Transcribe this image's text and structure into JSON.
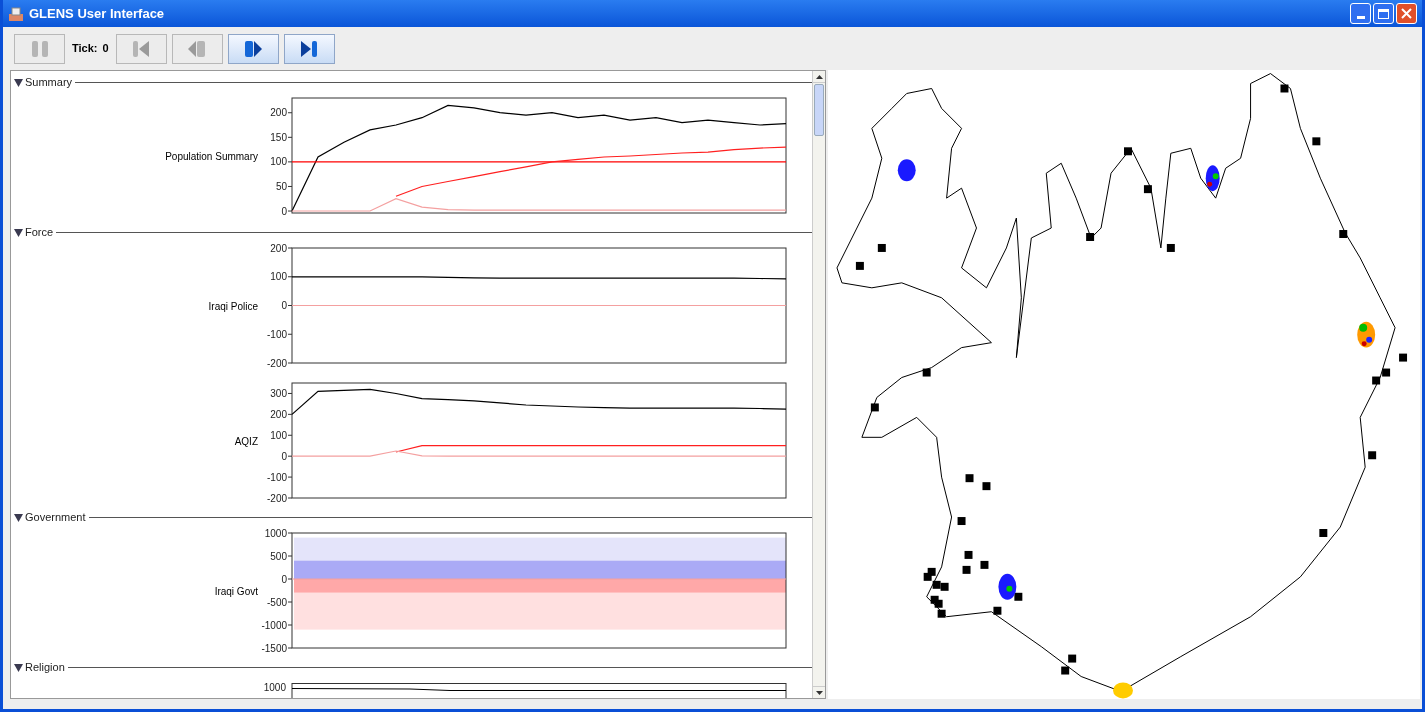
{
  "window": {
    "title": "GLENS User Interface"
  },
  "toolbar": {
    "pause_button": {
      "kind": "pause",
      "disabled": true
    },
    "tick_label": "Tick:",
    "tick_value": "0",
    "buttons": [
      {
        "kind": "first",
        "disabled": true
      },
      {
        "kind": "back",
        "disabled": true
      },
      {
        "kind": "play",
        "disabled": false
      },
      {
        "kind": "last",
        "disabled": false
      }
    ]
  },
  "sections": [
    {
      "title": "Summary",
      "expanded": true,
      "charts": [
        {
          "label": "Population Summary",
          "chart_data": {
            "type": "line",
            "ylim": [
              -4,
              230
            ],
            "yticks": [
              0,
              50,
              100,
              150,
              200
            ],
            "series": [
              {
                "color": "#000000",
                "values": [
                  0,
                  110,
                  140,
                  165,
                  175,
                  190,
                  215,
                  210,
                  200,
                  195,
                  200,
                  190,
                  195,
                  185,
                  190,
                  180,
                  185,
                  180,
                  175,
                  178
                ]
              },
              {
                "color": "#ff0000",
                "values": [
                  100,
                  100,
                  100,
                  100,
                  100,
                  100,
                  100,
                  100,
                  100,
                  100,
                  100,
                  100,
                  100,
                  100,
                  100,
                  100,
                  100,
                  100,
                  100,
                  100
                ]
              },
              {
                "color": "#ff2020",
                "values": [
                  null,
                  null,
                  null,
                  null,
                  30,
                  50,
                  60,
                  70,
                  80,
                  90,
                  100,
                  105,
                  110,
                  112,
                  115,
                  118,
                  120,
                  125,
                  128,
                  130
                ]
              },
              {
                "color": "#f4a0a0",
                "values": [
                  0,
                  0,
                  0,
                  0,
                  25,
                  8,
                  3,
                  2,
                  2,
                  2,
                  2,
                  2,
                  2,
                  2,
                  2,
                  2,
                  2,
                  2,
                  2,
                  2
                ]
              }
            ]
          }
        }
      ]
    },
    {
      "title": "Force",
      "expanded": true,
      "charts": [
        {
          "label": "Iraqi Police",
          "chart_data": {
            "type": "line",
            "ylim": [
              -200,
              200
            ],
            "yticks": [
              -200,
              -100,
              0,
              100,
              200
            ],
            "series": [
              {
                "color": "#000000",
                "values": [
                  100,
                  100,
                  100,
                  100,
                  100,
                  100,
                  98,
                  96,
                  95,
                  95,
                  95,
                  95,
                  95,
                  95,
                  95,
                  95,
                  95,
                  95,
                  94,
                  93
                ]
              },
              {
                "color": "#f4a0a0",
                "values": [
                  0,
                  0,
                  0,
                  0,
                  0,
                  0,
                  0,
                  0,
                  0,
                  0,
                  0,
                  0,
                  0,
                  0,
                  0,
                  0,
                  0,
                  0,
                  0,
                  0
                ]
              }
            ]
          }
        },
        {
          "label": "AQIZ",
          "chart_data": {
            "type": "line",
            "ylim": [
              -200,
              350
            ],
            "yticks": [
              -200,
              -100,
              0,
              100,
              200,
              300
            ],
            "series": [
              {
                "color": "#000000",
                "values": [
                  200,
                  310,
                  315,
                  320,
                  300,
                  275,
                  270,
                  265,
                  255,
                  245,
                  240,
                  235,
                  232,
                  230,
                  230,
                  230,
                  230,
                  230,
                  228,
                  225
                ]
              },
              {
                "color": "#ff2020",
                "values": [
                  null,
                  null,
                  null,
                  null,
                  20,
                  50,
                  50,
                  50,
                  50,
                  50,
                  50,
                  50,
                  50,
                  50,
                  50,
                  50,
                  50,
                  50,
                  50,
                  50
                ]
              },
              {
                "color": "#f4a0a0",
                "values": [
                  0,
                  0,
                  0,
                  0,
                  25,
                  2,
                  0,
                  0,
                  0,
                  0,
                  0,
                  0,
                  0,
                  0,
                  0,
                  0,
                  0,
                  0,
                  0,
                  0
                ]
              }
            ]
          }
        }
      ]
    },
    {
      "title": "Government",
      "expanded": true,
      "charts": [
        {
          "label": "Iraqi Govt",
          "chart_data": {
            "type": "line",
            "ylim": [
              -1500,
              1000
            ],
            "yticks": [
              -1500,
              -1000,
              -500,
              0,
              500,
              1000
            ],
            "bands": [
              {
                "axis": "y",
                "from": 400,
                "to": 900,
                "color": "#e4e4fa"
              },
              {
                "axis": "y",
                "from": 0,
                "to": 400,
                "color": "#aaaaf6"
              },
              {
                "axis": "y",
                "from": -300,
                "to": 0,
                "color": "#ffa8a8"
              },
              {
                "axis": "y",
                "from": -1100,
                "to": -300,
                "color": "#ffe0e0"
              }
            ],
            "series": [
              {
                "color": "#f4a0a0",
                "values": [
                  0,
                  0,
                  0,
                  0,
                  0,
                  0,
                  0,
                  0,
                  0,
                  0,
                  0,
                  0,
                  0,
                  0,
                  0,
                  0,
                  0,
                  0,
                  0,
                  0
                ]
              }
            ]
          }
        }
      ]
    },
    {
      "title": "Religion",
      "expanded": true,
      "charts": [
        {
          "top_value": "1000"
        }
      ]
    }
  ]
}
